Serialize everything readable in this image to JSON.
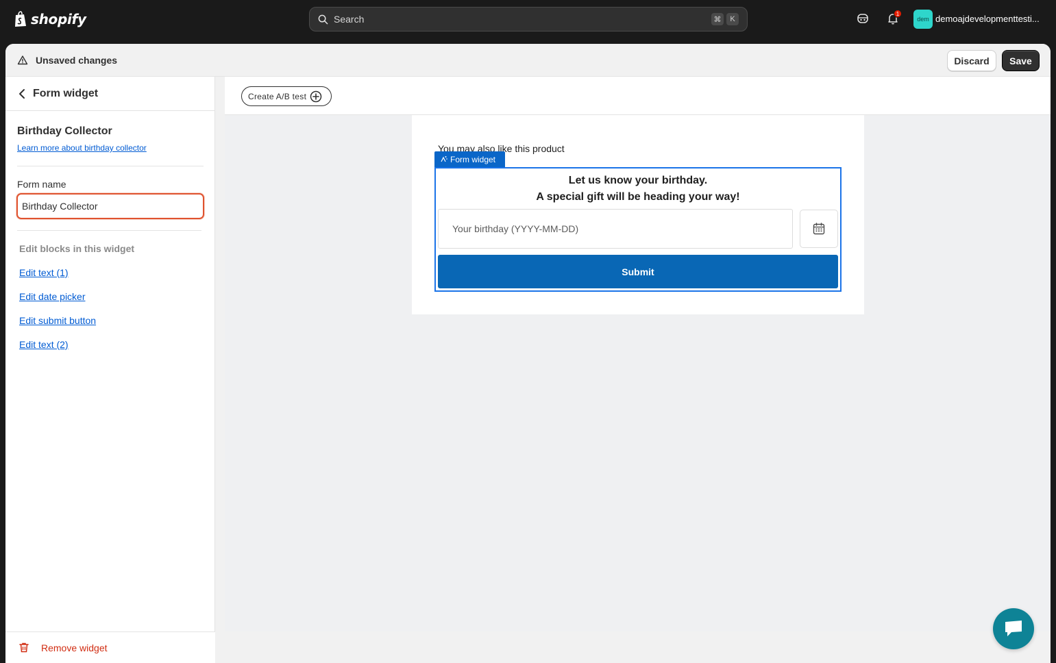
{
  "topbar": {
    "logo_text": "shopify",
    "search_placeholder": "Search",
    "shortcut_cmd": "⌘",
    "shortcut_key": "K",
    "notification_count": "1",
    "store_avatar_text": "dem",
    "store_name": "demoajdevelopmenttesti..."
  },
  "save_bar": {
    "status_text": "Unsaved changes",
    "discard_label": "Discard",
    "save_label": "Save"
  },
  "sidebar": {
    "title": "Form widget",
    "section_title": "Birthday Collector",
    "learn_more_link": "Learn more about birthday collector",
    "form_name_label": "Form name",
    "form_name_value": "Birthday Collector",
    "blocks_heading": "Edit blocks in this widget",
    "block_links": [
      "Edit text (1)",
      "Edit date picker",
      "Edit submit button",
      "Edit text (2)"
    ],
    "remove_label": "Remove widget"
  },
  "main": {
    "ab_test_label": "Create A/B test",
    "preview_text": "You may also like this product",
    "widget_tag": "Form widget",
    "heading_line1": "Let us know your birthday.",
    "heading_line2": "A special gift will be heading your way!",
    "birthday_placeholder": "Your birthday (YYYY-MM-DD)",
    "submit_label": "Submit"
  },
  "colors": {
    "topbar_bg": "#1a1a1a",
    "link": "#005bd3",
    "submit_bg": "#0967b5",
    "danger": "#d12d12",
    "chat_bg": "#0e8396",
    "input_focus_border": "#e0532f"
  },
  "icons": [
    "shopify-bag-icon",
    "search-icon",
    "assistant-icon",
    "bell-icon",
    "warning-icon",
    "chevron-left-icon",
    "trash-icon",
    "plus-circle-icon",
    "sparkle-icon",
    "calendar-icon",
    "chat-icon"
  ]
}
